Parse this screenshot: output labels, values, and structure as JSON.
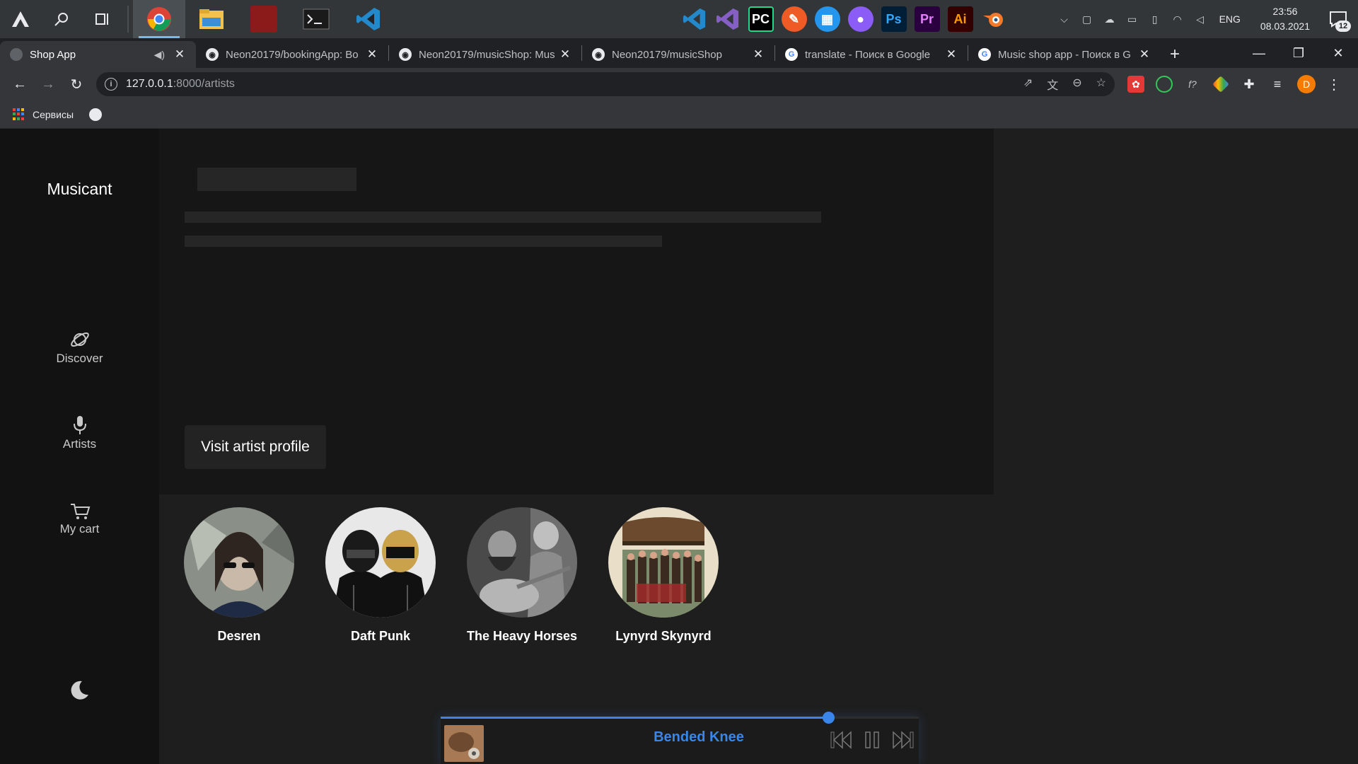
{
  "taskbar": {
    "clock_time": "23:56",
    "clock_date": "08.03.2021",
    "language": "ENG",
    "notification_count": "12"
  },
  "tabs": [
    {
      "title": "Shop App",
      "favicon": "dot-icon",
      "active": true
    },
    {
      "title": "Neon20179/bookingApp: Bo",
      "favicon": "github-icon"
    },
    {
      "title": "Neon20179/musicShop: Mus",
      "favicon": "github-icon"
    },
    {
      "title": "Neon20179/musicShop",
      "favicon": "github-icon"
    },
    {
      "title": "translate - Поиск в Google",
      "favicon": "google-icon"
    },
    {
      "title": "Music shop app - Поиск в G",
      "favicon": "google-icon"
    }
  ],
  "address": {
    "host": "127.0.0.1",
    "path": ":8000/artists"
  },
  "bookmarks": {
    "services_label": "Сервисы"
  },
  "avatar_letter": "D",
  "app": {
    "brand": "Musicant",
    "nav": [
      {
        "label": "Discover",
        "icon": "planet-icon"
      },
      {
        "label": "Artists",
        "icon": "microphone-icon"
      },
      {
        "label": "My cart",
        "icon": "cart-icon"
      }
    ],
    "visit_button": "Visit artist profile",
    "artists": [
      {
        "name": "Desren"
      },
      {
        "name": "Daft Punk"
      },
      {
        "name": "The Heavy Horses"
      },
      {
        "name": "Lynyrd Skynyrd"
      }
    ],
    "player": {
      "track_title": "Bended Knee",
      "progress": 0.81,
      "accent": "#3a86e8"
    }
  }
}
